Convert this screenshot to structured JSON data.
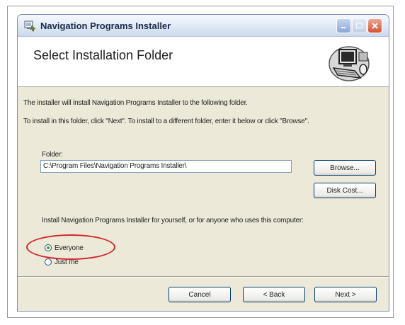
{
  "window": {
    "title": "Navigation Programs Installer"
  },
  "header": {
    "title": "Select Installation Folder",
    "graphic": "computer-installer-graphic"
  },
  "body": {
    "intro_line": "The installer will install Navigation Programs Installer to the following folder.",
    "instruction_line": "To install in this folder, click \"Next\". To install to a different folder, enter it below or click \"Browse\".",
    "folder_label": "Folder:",
    "folder_value": "C:\\Program Files\\Navigation Programs Installer\\",
    "browse_label": "Browse...",
    "disk_cost_label": "Disk Cost...",
    "install_question": "Install Navigation Programs Installer for yourself, or for anyone who uses this computer:",
    "radio_options": [
      {
        "label": "Everyone",
        "selected": true
      },
      {
        "label": "Just me",
        "selected": false
      }
    ]
  },
  "footer": {
    "cancel_label": "Cancel",
    "back_label": "< Back",
    "next_label": "Next >"
  },
  "annotation": {
    "highlight_color": "#d0262e"
  },
  "colors": {
    "dialog_bg": "#ece9d8",
    "header_bg": "#ffffff",
    "close_button": "#d65132"
  }
}
